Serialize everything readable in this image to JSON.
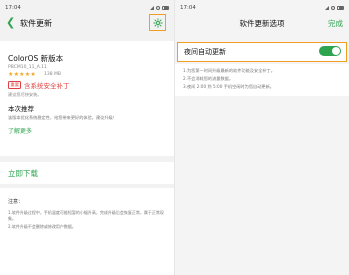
{
  "left": {
    "status": {
      "time": "17:04"
    },
    "nav": {
      "title": "软件更新",
      "back_icon": "back-arrow-icon",
      "settings_icon": "gear-icon"
    },
    "card": {
      "title": "ColorOS 新版本",
      "version": "PBCM10_11_A.11",
      "stars": "★★★★★",
      "size": "138 MB",
      "tag": "重要",
      "tag_text": "含系统安全补丁",
      "hint": "建议您尽快安装。",
      "section_title": "本次推荐",
      "recommend": "该版本优化系统稳定性，给您带来更好的体验，建议升级！",
      "more": "了解更多"
    },
    "download": "立即下载",
    "notes": {
      "title": "注意：",
      "items": [
        "1.软件升级过程中，手机温度可能短暂的小幅升高，完成升级后会恢复正常，属于正常现象。",
        "2.软件升级不会删除或修改用户数据。"
      ]
    }
  },
  "right": {
    "status": {
      "time": "17:04"
    },
    "nav": {
      "title": "软件更新选项",
      "done": "完成"
    },
    "toggle": {
      "label": "夜间自动更新",
      "on": true
    },
    "notes": [
      "1.为您第一时间升级最新的软件功能及安全补丁。",
      "2.不会消耗您的流量数据。",
      "3.夜间 2:00 到 5:00 手机空闲时为您自动更新。"
    ]
  },
  "colors": {
    "accent": "#2ea44f",
    "highlight": "#f0a020",
    "warning": "#e04040",
    "star": "#f5a623"
  }
}
